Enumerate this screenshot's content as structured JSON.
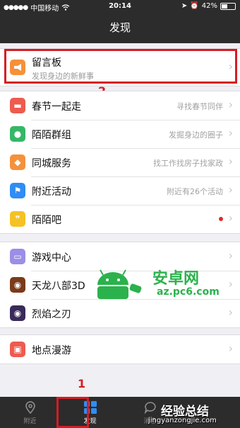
{
  "status_bar": {
    "carrier": "中国移动",
    "time": "20:14",
    "battery": "42%"
  },
  "nav": {
    "title": "发现"
  },
  "message_board": {
    "title": "留言板",
    "desc": "发现身边的新鲜事",
    "icon": "megaphone-icon",
    "icon_color": "#f5913a"
  },
  "group2": [
    {
      "label": "春节一起走",
      "sub": "寻找春节同伴",
      "icon": "lantern-icon",
      "color": "#ee5b4f"
    },
    {
      "label": "陌陌群组",
      "sub": "发掘身边的圈子",
      "icon": "group-icon",
      "color": "#34b867"
    },
    {
      "label": "同城服务",
      "sub": "找工作找房子找家政",
      "icon": "tag-icon",
      "color": "#f5913a"
    },
    {
      "label": "附近活动",
      "sub": "附近有26个活动",
      "icon": "flag-icon",
      "color": "#2f8df5"
    },
    {
      "label": "陌陌吧",
      "sub": "",
      "icon": "quote-icon",
      "color": "#f5c223"
    }
  ],
  "group3": [
    {
      "label": "游戏中心",
      "icon": "gamepad-icon",
      "color": "#9a8ee6"
    },
    {
      "label": "天龙八部3D",
      "icon": "game-avatar-icon",
      "color": "#7a3b1a"
    },
    {
      "label": "烈焰之刃",
      "icon": "game-avatar-icon",
      "color": "#3a2a5a"
    }
  ],
  "group4": [
    {
      "label": "地点漫游",
      "icon": "suitcase-icon",
      "color": "#ee5b4f"
    }
  ],
  "tabs": [
    {
      "label": "附近",
      "icon": "location-pin-icon"
    },
    {
      "label": "发现",
      "icon": "grid-icon",
      "active": true
    },
    {
      "label": "消息",
      "icon": "chat-bubble-icon"
    }
  ],
  "annotations": {
    "one": "1",
    "two": "2"
  },
  "watermarks": {
    "pc6_title": "安卓网",
    "pc6_url": "az.pc6.com",
    "jy_title": "经验总结",
    "jy_url": "jingyanzongjie.com"
  }
}
